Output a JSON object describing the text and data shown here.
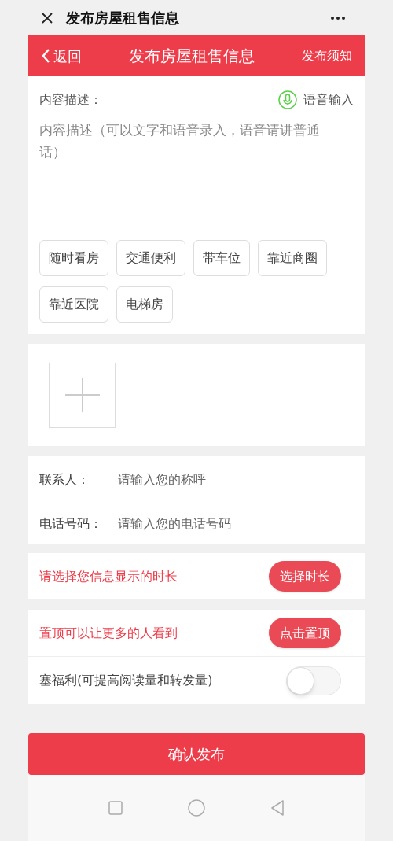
{
  "window": {
    "title": "发布房屋租售信息"
  },
  "header": {
    "back": "返回",
    "title": "发布房屋租售信息",
    "notice": "发布须知"
  },
  "description": {
    "label": "内容描述：",
    "voice_button": "语音输入",
    "placeholder": "内容描述（可以文字和语音录入，语音请讲普通话）"
  },
  "tags": [
    "随时看房",
    "交通便利",
    "带车位",
    "靠近商圈",
    "靠近医院",
    "电梯房"
  ],
  "contact": [
    {
      "label": "联系人：",
      "placeholder": "请输入您的称呼"
    },
    {
      "label": "电话号码：",
      "placeholder": "请输入您的电话号码"
    }
  ],
  "duration": {
    "prompt": "请选择您信息显示的时长",
    "button": "选择时长"
  },
  "pin": {
    "prompt": "置顶可以让更多的人看到",
    "button": "点击置顶"
  },
  "welfare": {
    "label": "塞福利(可提高阅读量和转发量)",
    "on": false
  },
  "submit": "确认发布"
}
